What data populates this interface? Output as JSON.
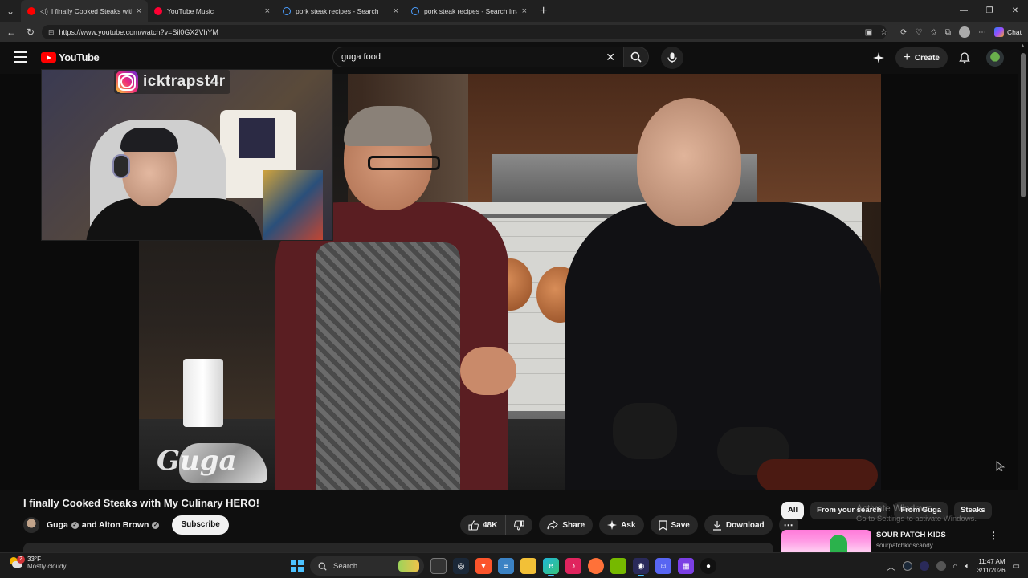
{
  "browser": {
    "tabs": [
      {
        "title": "I finally Cooked Steaks with My Culinary HERO!",
        "favicon_color": "#ff0000",
        "active": true
      },
      {
        "title": "YouTube Music",
        "favicon_color": "#ff0033",
        "active": false
      },
      {
        "title": "pork steak recipes - Search",
        "favicon_color": "#4a9eff",
        "active": false
      },
      {
        "title": "pork steak recipes - Search Images",
        "favicon_color": "#4a9eff",
        "active": false
      }
    ],
    "url": "https://www.youtube.com/watch?v=Sil0GX2VhYM",
    "chat_label": "Chat"
  },
  "youtube": {
    "logo_text": "YouTube",
    "search_query": "guga food",
    "create_label": "Create"
  },
  "overlay": {
    "instagram_handle": "icktrapst4r",
    "watermark": "Guga"
  },
  "video": {
    "title": "I finally Cooked Steaks with My Culinary HERO!",
    "channel": "Guga",
    "channel_connector": "and",
    "collaborator": "Alton Brown",
    "subscribe_label": "Subscribe",
    "likes": "48K",
    "share_label": "Share",
    "ask_label": "Ask",
    "save_label": "Save",
    "download_label": "Download"
  },
  "chips": [
    "All",
    "From your search",
    "From Guga",
    "Steaks"
  ],
  "recommendation": {
    "title": "SOUR PATCH KIDS",
    "channel": "sourpatchkidscandy"
  },
  "activate_windows": {
    "line1": "Activate Windows",
    "line2": "Go to Settings to activate Windows."
  },
  "taskbar": {
    "temperature": "33°F",
    "condition": "Mostly cloudy",
    "weather_badge": "2",
    "search_placeholder": "Search",
    "time": "11:47 AM",
    "date": "3/11/2026"
  },
  "colors": {
    "youtube_red": "#ff0000",
    "background": "#0f0f0f",
    "chip_bg": "#272727",
    "taskbar_accent": "#4cc2ff"
  }
}
